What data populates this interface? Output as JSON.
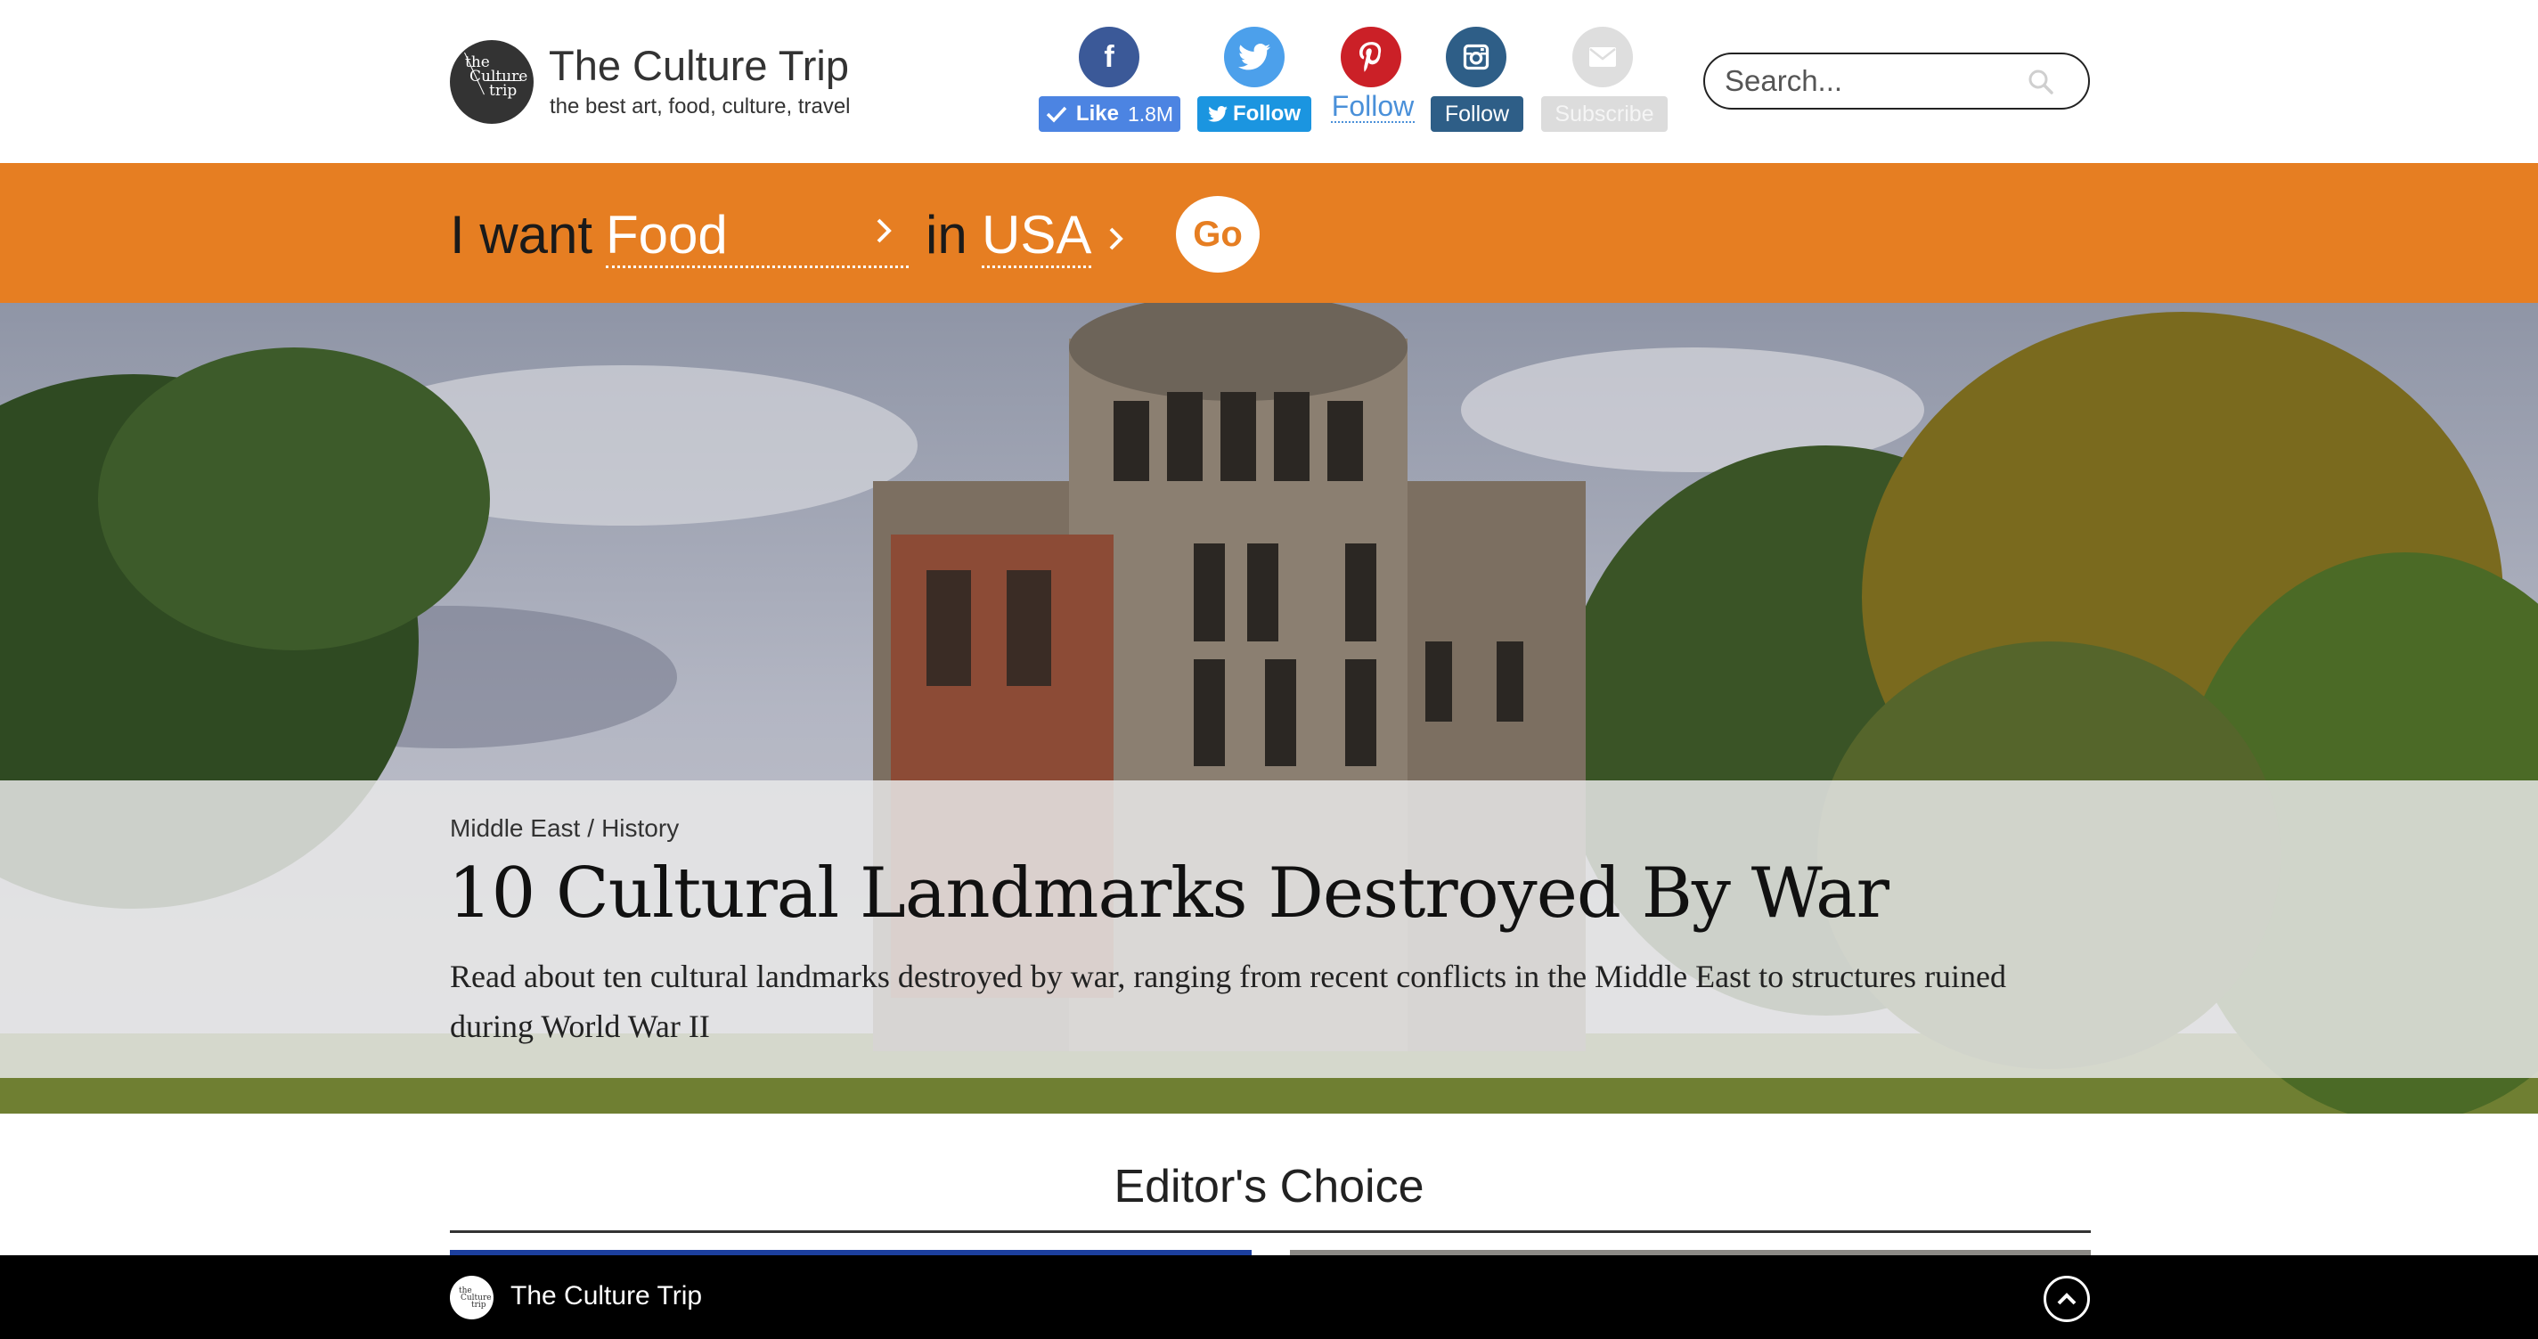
{
  "header": {
    "logo_text": [
      "the",
      "Culture",
      "trip"
    ],
    "brand_title": "The Culture Trip",
    "tagline": "the best art, food, culture, travel",
    "social": {
      "facebook": {
        "icon": "facebook-icon",
        "like_label": "Like",
        "like_count": "1.8M",
        "color": "#3b5998"
      },
      "twitter": {
        "icon": "twitter-icon",
        "follow_label": "Follow",
        "color": "#4ca0eb"
      },
      "pinterest": {
        "icon": "pinterest-icon",
        "follow_label": "Follow",
        "color": "#cb2027"
      },
      "instagram": {
        "icon": "instagram-icon",
        "follow_label": "Follow",
        "color": "#2e5e87"
      },
      "email": {
        "icon": "envelope-icon",
        "subscribe_label": "Subscribe",
        "color": "#dedede"
      }
    },
    "search": {
      "placeholder": "Search...",
      "icon": "search-icon"
    }
  },
  "finder": {
    "want_label": "I want",
    "want_value": "Food",
    "in_label": "in",
    "where_value": "USA",
    "go_label": "Go",
    "accent": "#e67e22"
  },
  "hero": {
    "breadcrumb": {
      "region": "Middle East",
      "separator": "/",
      "category": "History"
    },
    "title": "10 Cultural Landmarks Destroyed By War",
    "description": "Read about ten cultural landmarks destroyed by war, ranging from recent conflicts in the Middle East to structures ruined during World War II"
  },
  "editors_choice": {
    "title": "Editor's Choice"
  },
  "footer": {
    "title": "The Culture Trip",
    "back_to_top_icon": "chevron-up-icon"
  }
}
